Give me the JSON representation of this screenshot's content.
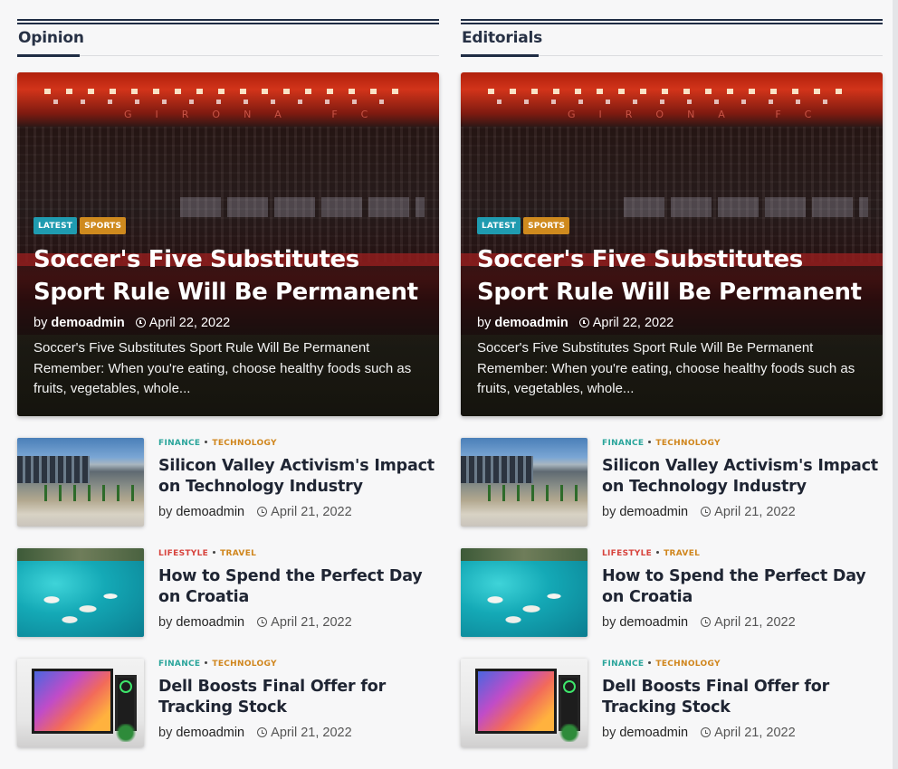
{
  "columns": [
    {
      "section_title": "Opinion",
      "hero": {
        "tags": [
          "LATEST",
          "SPORTS"
        ],
        "stadium_text": "GIRONA FC",
        "title": "Soccer's Five Substitutes Sport Rule Will Be Permanent",
        "by": "by",
        "author": "demoadmin",
        "date": "April 22, 2022",
        "excerpt": "Soccer's Five Substitutes Sport Rule Will Be Permanent Remember: When you're eating, choose healthy foods such as fruits, vegetables, whole..."
      },
      "items": [
        {
          "cat1": "FINANCE",
          "cat2": "TECHNOLOGY",
          "title": "Silicon Valley Activism's Impact on Technology Industry",
          "by": "by",
          "author": "demoadmin",
          "date": "April 21, 2022"
        },
        {
          "cat1": "LIFESTYLE",
          "cat2": "TRAVEL",
          "title": "How to Spend the Perfect Day on Croatia",
          "by": "by",
          "author": "demoadmin",
          "date": "April 21, 2022"
        },
        {
          "cat1": "FINANCE",
          "cat2": "TECHNOLOGY",
          "title": "Dell Boosts Final Offer for Tracking Stock",
          "by": "by",
          "author": "demoadmin",
          "date": "April 21, 2022"
        }
      ]
    },
    {
      "section_title": "Editorials",
      "hero": {
        "tags": [
          "LATEST",
          "SPORTS"
        ],
        "stadium_text": "GIRONA FC",
        "title": "Soccer's Five Substitutes Sport Rule Will Be Permanent",
        "by": "by",
        "author": "demoadmin",
        "date": "April 22, 2022",
        "excerpt": "Soccer's Five Substitutes Sport Rule Will Be Permanent Remember: When you're eating, choose healthy foods such as fruits, vegetables, whole..."
      },
      "items": [
        {
          "cat1": "FINANCE",
          "cat2": "TECHNOLOGY",
          "title": "Silicon Valley Activism's Impact on Technology Industry",
          "by": "by",
          "author": "demoadmin",
          "date": "April 21, 2022"
        },
        {
          "cat1": "LIFESTYLE",
          "cat2": "TRAVEL",
          "title": "How to Spend the Perfect Day on Croatia",
          "by": "by",
          "author": "demoadmin",
          "date": "April 21, 2022"
        },
        {
          "cat1": "FINANCE",
          "cat2": "TECHNOLOGY",
          "title": "Dell Boosts Final Offer for Tracking Stock",
          "by": "by",
          "author": "demoadmin",
          "date": "April 21, 2022"
        }
      ]
    }
  ],
  "colors": {
    "navy": "#1f2c44",
    "tag_latest": "#1f9bb0",
    "tag_sports": "#cf8a1e",
    "cat_finance": "#2aa59b",
    "cat_lifestyle": "#d7433d",
    "cat_orange": "#d0861d"
  },
  "icons": {
    "date": "clock-icon"
  }
}
